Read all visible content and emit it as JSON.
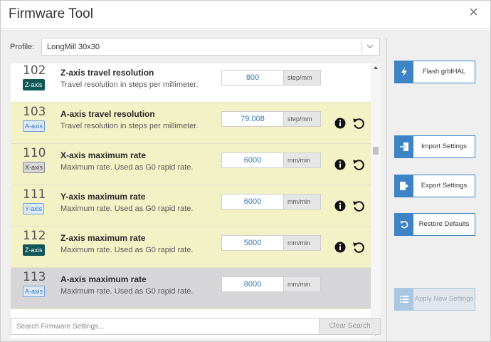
{
  "window": {
    "title": "Firmware Tool",
    "close_glyph": "×"
  },
  "profile": {
    "label": "Profile:",
    "value": "LongMill 30x30"
  },
  "settings": [
    {
      "id": "102",
      "axis": "Z-axis",
      "title": "Z-axis travel resolution",
      "desc": "Travel resolution in steps per millimeter.",
      "value": "800",
      "unit": "step/mm"
    },
    {
      "id": "103",
      "axis": "A-axis",
      "title": "A-axis travel resolution",
      "desc": "Travel resolution in steps per millimeter.",
      "value": "79.008",
      "unit": "step/mm"
    },
    {
      "id": "110",
      "axis": "X-axis",
      "title": "X-axis maximum rate",
      "desc": "Maximum rate. Used as G0 rapid rate.",
      "value": "6000",
      "unit": "mm/min"
    },
    {
      "id": "111",
      "axis": "Y-axis",
      "title": "Y-axis maximum rate",
      "desc": "Maximum rate. Used as G0 rapid rate.",
      "value": "6000",
      "unit": "mm/min"
    },
    {
      "id": "112",
      "axis": "Z-axis",
      "title": "Z-axis maximum rate",
      "desc": "Maximum rate. Used as G0 rapid rate.",
      "value": "5000",
      "unit": "mm/min"
    },
    {
      "id": "113",
      "axis": "A-axis",
      "title": "A-axis maximum rate",
      "desc": "Maximum rate. Used as G0 rapid rate.",
      "value": "8000",
      "unit": "mm/min"
    }
  ],
  "actions": {
    "flash": "Flash grblHAL",
    "import": "Import Settings",
    "export": "Export Settings",
    "restore": "Restore Defaults",
    "apply": "Apply New Settings"
  },
  "search": {
    "placeholder": "Search Firmware Settings...",
    "clear": "Clear Search"
  },
  "colors": {
    "accent": "#3d83c6",
    "row_modified": "#f3f1c6",
    "row_selected": "#d6d6d8",
    "badge_z": "#0f5757"
  },
  "icons": [
    "close-icon",
    "chevron-down-icon",
    "info-icon",
    "reset-icon",
    "bolt-icon",
    "import-icon",
    "export-icon",
    "restore-icon",
    "list-icon"
  ]
}
